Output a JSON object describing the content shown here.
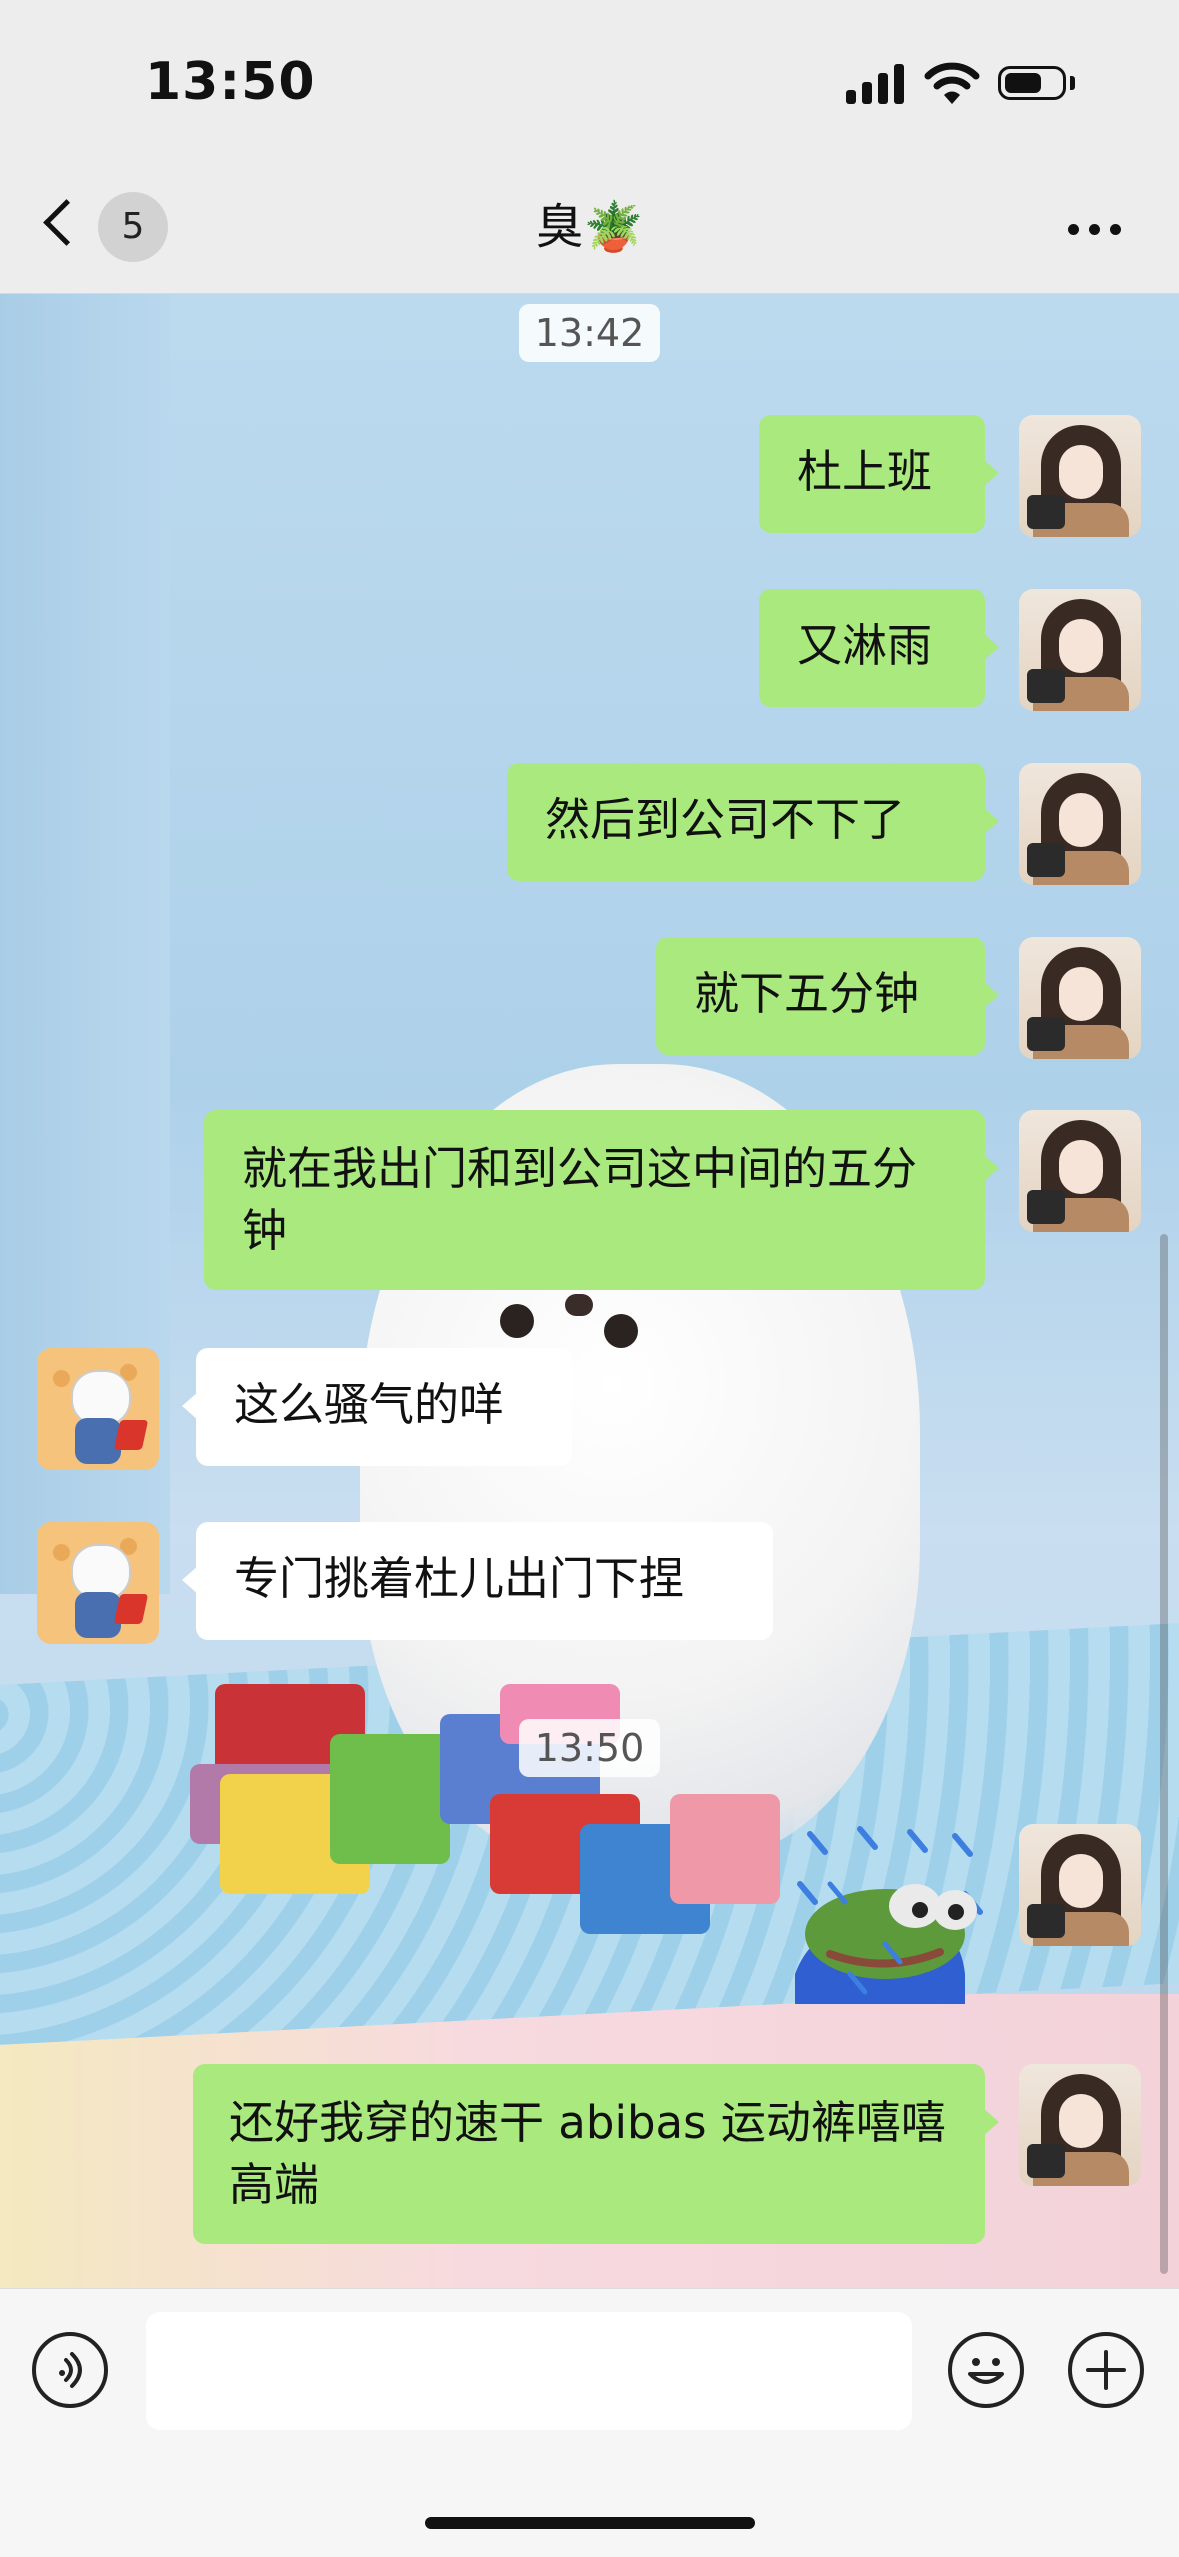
{
  "status_bar": {
    "time": "13:50"
  },
  "nav": {
    "unread_count": "5",
    "title": "臭🪴"
  },
  "timestamps": [
    "13:42",
    "13:50"
  ],
  "messages": [
    {
      "from": "me",
      "text": "杜上班"
    },
    {
      "from": "me",
      "text": "又淋雨"
    },
    {
      "from": "me",
      "text": "然后到公司不下了"
    },
    {
      "from": "me",
      "text": "就下五分钟"
    },
    {
      "from": "me",
      "text": "就在我出门和到公司这中间的五分钟"
    },
    {
      "from": "them",
      "text": "这么骚气的咩"
    },
    {
      "from": "them",
      "text": "专门挑着杜儿出门下捏"
    },
    {
      "from": "me",
      "type": "sticker",
      "sticker": "crying-frog-sticker"
    },
    {
      "from": "me",
      "text": "还好我穿的速干 abibas 运动裤嘻嘻 高端"
    }
  ],
  "input": {
    "value": ""
  },
  "icons": [
    "back-chevron-icon",
    "more-dots-icon",
    "voice-icon",
    "emoji-icon",
    "plus-icon"
  ],
  "colors": {
    "outgoing_bubble": "#a9e97d",
    "incoming_bubble": "#ffffff",
    "bar_background": "#ededed"
  }
}
